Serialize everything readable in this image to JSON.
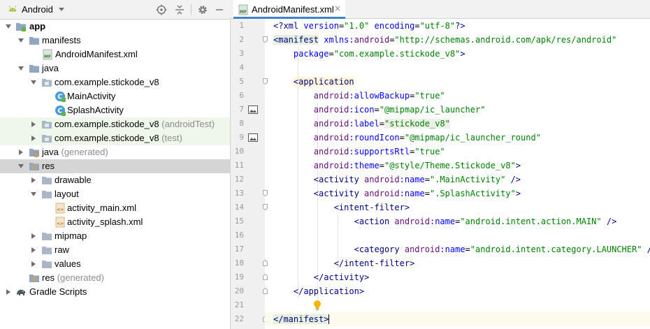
{
  "project_panel": {
    "title": "Android",
    "items": [
      {
        "label": "app",
        "suffix": ""
      },
      {
        "label": "manifests",
        "suffix": ""
      },
      {
        "label": "AndroidManifest.xml",
        "suffix": ""
      },
      {
        "label": "java",
        "suffix": ""
      },
      {
        "label": "com.example.stickode_v8",
        "suffix": ""
      },
      {
        "label": "MainActivity",
        "suffix": ""
      },
      {
        "label": "SplashActivity",
        "suffix": ""
      },
      {
        "label": "com.example.stickode_v8",
        "suffix": "(androidTest)"
      },
      {
        "label": "com.example.stickode_v8",
        "suffix": "(test)"
      },
      {
        "label": "java",
        "suffix": "(generated)"
      },
      {
        "label": "res",
        "suffix": ""
      },
      {
        "label": "drawable",
        "suffix": ""
      },
      {
        "label": "layout",
        "suffix": ""
      },
      {
        "label": "activity_main.xml",
        "suffix": ""
      },
      {
        "label": "activity_splash.xml",
        "suffix": ""
      },
      {
        "label": "mipmap",
        "suffix": ""
      },
      {
        "label": "raw",
        "suffix": ""
      },
      {
        "label": "values",
        "suffix": ""
      },
      {
        "label": "res",
        "suffix": "(generated)"
      },
      {
        "label": "Gradle Scripts",
        "suffix": ""
      }
    ]
  },
  "editor": {
    "tab_label": "AndroidManifest.xml",
    "tab_icon_text": "MF",
    "tab_close": "×",
    "line_numbers": [
      "1",
      "2",
      "3",
      "4",
      "5",
      "6",
      "7",
      "8",
      "9",
      "10",
      "11",
      "12",
      "13",
      "14",
      "15",
      "16",
      "17",
      "18",
      "19",
      "20",
      "21",
      "22"
    ],
    "lines": {
      "l1": {
        "a": "<?xml ",
        "b": "version",
        "c": "=",
        "d": "\"1.0\"",
        "e": " ",
        "f": "encoding",
        "g": "=",
        "h": "\"utf-8\"",
        "i": "?>"
      },
      "l2": {
        "tag": "<manifest",
        "ns": " xmlns:",
        "nsname": "android",
        "eq": "=",
        "val": "\"http://schemas.android.com/apk/res/android\""
      },
      "l3": {
        "attr": "package",
        "eq": "=",
        "val": "\"com.example.stickode_v8\"",
        "close": ">"
      },
      "l5": {
        "tag": "<application"
      },
      "l6": {
        "ns": "android",
        "attr": ":allowBackup",
        "eq": "=",
        "val": "\"true\""
      },
      "l7": {
        "ns": "android",
        "attr": ":icon",
        "eq": "=",
        "val": "\"@mipmap/ic_launcher\""
      },
      "l8": {
        "ns": "android",
        "attr": ":label",
        "eq": "=",
        "val": "\"stickode_v8\""
      },
      "l9": {
        "ns": "android",
        "attr": ":roundIcon",
        "eq": "=",
        "val": "\"@mipmap/ic_launcher_round\""
      },
      "l10": {
        "ns": "android",
        "attr": ":supportsRtl",
        "eq": "=",
        "val": "\"true\""
      },
      "l11": {
        "ns": "android",
        "attr": ":theme",
        "eq": "=",
        "val": "\"@style/Theme.Stickode_v8\"",
        "close": ">"
      },
      "l12": {
        "tag": "<activity",
        "ns": " android",
        "attr": ":name",
        "eq": "=",
        "val": "\".MainActivity\"",
        "close": " />"
      },
      "l13": {
        "tag": "<activity",
        "ns": " android",
        "attr": ":name",
        "eq": "=",
        "val": "\".SplashActivity\"",
        "close": ">"
      },
      "l14": {
        "tag": "<intent-filter",
        "close": ">"
      },
      "l15": {
        "tag": "<action",
        "ns": " android",
        "attr": ":name",
        "eq": "=",
        "val": "\"android.intent.action.MAIN\"",
        "close": " />"
      },
      "l17": {
        "tag": "<category",
        "ns": " android",
        "attr": ":name",
        "eq": "=",
        "val": "\"android.intent.category.LAUNCHER\"",
        "close": " />"
      },
      "l18": {
        "tag": "</intent-filter>"
      },
      "l19": {
        "tag": "</activity>"
      },
      "l20": {
        "tag": "</application>"
      },
      "l22": {
        "tag": "</manifest>"
      }
    }
  },
  "colors": {
    "accent": "#4083c9",
    "selected_row": "#d5d5d5",
    "test_row": "#eef7e9",
    "caret_line": "#fcfaed"
  }
}
